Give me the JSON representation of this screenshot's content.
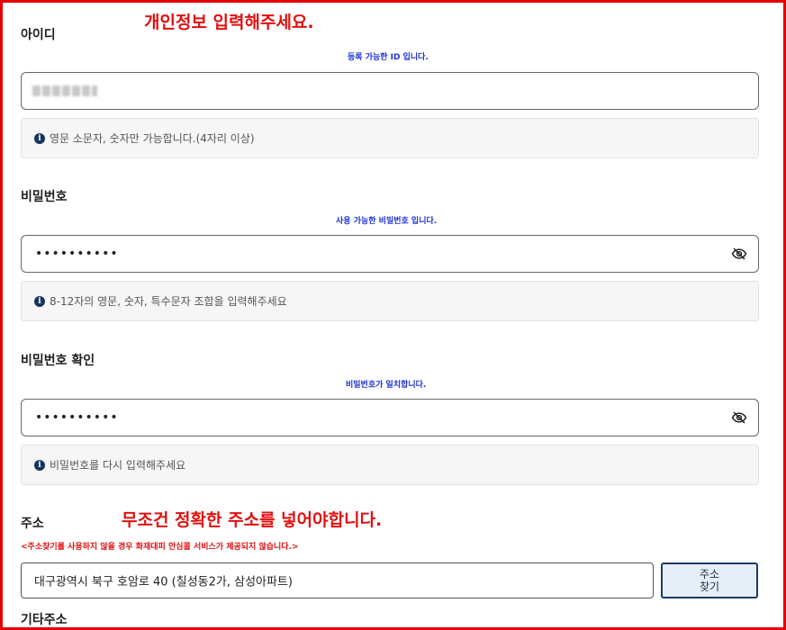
{
  "annotations": {
    "top": "개인정보 입력해주세요.",
    "address": "무조건 정확한 주소를 넣어야합니다."
  },
  "id_section": {
    "label": "아이디",
    "status": "등록 가능한 ID 입니다.",
    "hint": "영문 소문자, 숫자만 가능합니다.(4자리 이상)"
  },
  "password_section": {
    "label": "비밀번호",
    "status": "사용 가능한 비밀번호 입니다.",
    "value_mask": "••••••••••",
    "hint": "8-12자의 영문, 숫자, 특수문자 조합을 입력해주세요"
  },
  "password_confirm_section": {
    "label": "비밀번호 확인",
    "status": "비밀번호가 일치합니다.",
    "value_mask": "••••••••••",
    "hint": "비밀번호를 다시 입력해주세요"
  },
  "address_section": {
    "label": "주소",
    "warning": "<주소찾기를 사용하지 않을 경우 화재대피 안심콜 서비스가 제공되지 않습니다.>",
    "value": "대구광역시 북구 호암로 40 (칠성동2가, 삼성아파트)",
    "search_button_line1": "주소",
    "search_button_line2": "찾기"
  },
  "detail_address_section": {
    "label": "기타주소"
  },
  "icons": {
    "info": "info-icon",
    "toggle_password": "eye-slash-icon"
  },
  "colors": {
    "annotation_red": "#e01010",
    "status_blue": "#1c2fd6",
    "frame_red": "#e30000",
    "button_border": "#1c3a66"
  }
}
